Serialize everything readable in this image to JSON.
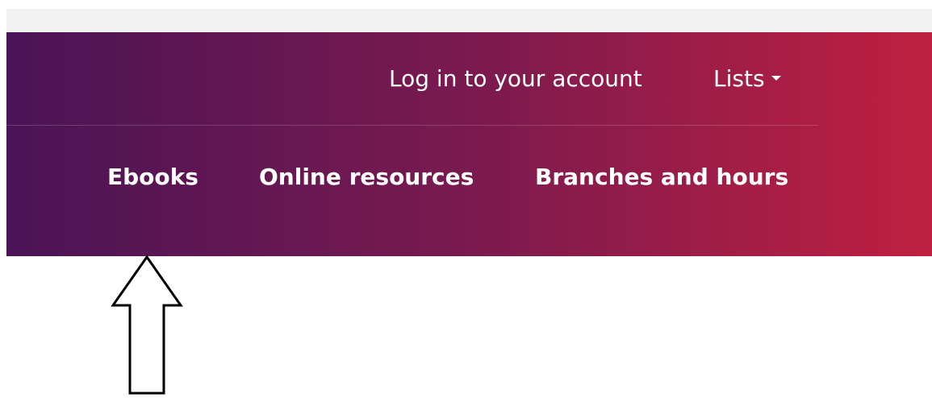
{
  "colors": {
    "header_gradient_start": "#4a1456",
    "header_gradient_mid": "#7a1a4f",
    "header_gradient_end": "#bf2040",
    "nav_text": "#ffffff",
    "annotation_stroke": "#000000"
  },
  "utility_nav": {
    "login_label": "Log in to your account",
    "lists_label": "Lists"
  },
  "main_nav": {
    "items": [
      {
        "label": "Ebooks"
      },
      {
        "label": "Online resources"
      },
      {
        "label": "Branches and hours"
      }
    ]
  },
  "annotation": {
    "icon": "up-arrow-outline-icon",
    "points_to": "Ebooks"
  }
}
